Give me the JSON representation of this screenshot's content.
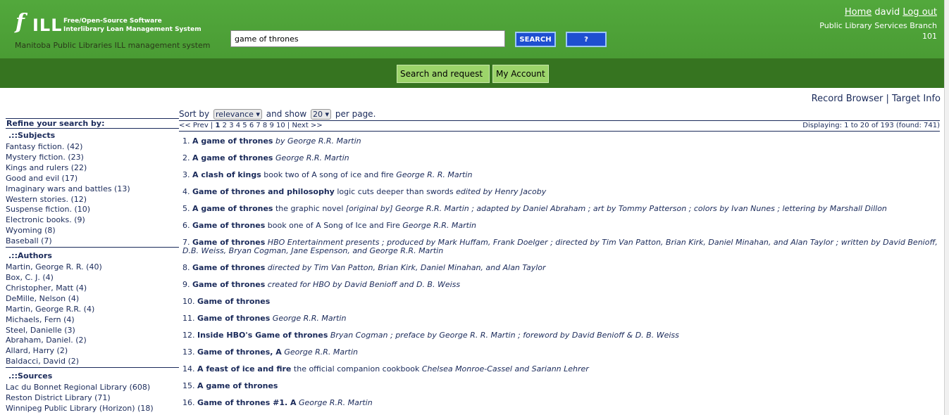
{
  "header": {
    "logo_f": "f",
    "logo_ill": "ILL",
    "logo_tag1": "Free/Open-Source Software",
    "logo_tag2": "Interlibrary Loan Management System",
    "subtitle": "Manitoba Public Libraries ILL management system",
    "search_value": "game of thrones",
    "search_button": "SEARCH",
    "help_button": "?",
    "home_link": "Home",
    "username": "david",
    "logout_link": "Log out",
    "branch": "Public Library Services Branch",
    "branch_num": "101"
  },
  "nav": {
    "search_request": "Search and request",
    "my_account": "My Account"
  },
  "record_links": "Record Browser | Target Info",
  "sidebar": {
    "refine_title": "Refine your search by:",
    "subjects_head": ".::Subjects",
    "subjects": [
      "Fantasy fiction. (42)",
      "Mystery fiction. (23)",
      "Kings and rulers (22)",
      "Good and evil (17)",
      "Imaginary wars and battles (13)",
      "Western stories. (12)",
      "Suspense fiction. (10)",
      "Electronic books. (9)",
      "Wyoming (8)",
      "Baseball (7)"
    ],
    "authors_head": ".::Authors",
    "authors": [
      "Martin, George R. R. (40)",
      "Box, C. J. (4)",
      "Christopher, Matt (4)",
      "DeMille, Nelson (4)",
      "Martin, George R.R. (4)",
      "Michaels, Fern (4)",
      "Steel, Danielle (3)",
      "Abraham, Daniel. (2)",
      "Allard, Harry (2)",
      "Baldacci, David (2)"
    ],
    "sources_head": ".::Sources",
    "sources": [
      "Lac du Bonnet Regional Library (608)",
      "Reston District Library (71)",
      "Winnipeg Public Library (Horizon) (18)"
    ]
  },
  "sort": {
    "sort_by": "Sort by",
    "sort_value": "relevance",
    "show": "and show",
    "show_value": "20",
    "per_page": "per page."
  },
  "pager": {
    "prev": "<< Prev |",
    "current": "1",
    "pages": "2 3 4 5 6 7 8 9 10",
    "next": "| Next >>",
    "displaying": "Displaying: 1 to 20 of 193 (found: 741)"
  },
  "results": [
    {
      "n": "1.",
      "title": "A game of thrones",
      "desc": "",
      "author": "by George R.R. Martin"
    },
    {
      "n": "2.",
      "title": "A game of thrones",
      "desc": "",
      "author": "George R.R. Martin"
    },
    {
      "n": "3.",
      "title": "A clash of kings",
      "desc": "book two of A song of ice and fire",
      "author": "George R. R. Martin"
    },
    {
      "n": "4.",
      "title": "Game of thrones and philosophy",
      "desc": "logic cuts deeper than swords",
      "author": "edited by Henry Jacoby"
    },
    {
      "n": "5.",
      "title": "A game of thrones",
      "desc": "the graphic novel",
      "author": "[original by] George R.R. Martin ; adapted by Daniel Abraham ; art by Tommy Patterson ; colors by Ivan Nunes ; lettering by Marshall Dillon"
    },
    {
      "n": "6.",
      "title": "Game of thrones",
      "desc": "book one of A Song of Ice and Fire",
      "author": "George R.R. Martin"
    },
    {
      "n": "7.",
      "title": "Game of thrones",
      "desc": "",
      "author": "HBO Entertainment presents ; produced by Mark Huffam, Frank Doelger ; directed by Tim Van Patton, Brian Kirk, Daniel Minahan, and Alan Taylor ; written by David Benioff, D.B. Weiss, Bryan Cogman, Jane Espenson, and George R.R. Martin"
    },
    {
      "n": "8.",
      "title": "Game of thrones",
      "desc": "",
      "author": "directed by Tim Van Patton, Brian Kirk, Daniel Minahan, and Alan Taylor"
    },
    {
      "n": "9.",
      "title": "Game of thrones",
      "desc": "",
      "author": "created for HBO by David Benioff and D. B. Weiss"
    },
    {
      "n": "10.",
      "title": "Game of thrones",
      "desc": "",
      "author": ""
    },
    {
      "n": "11.",
      "title": "Game of thrones",
      "desc": "",
      "author": "George R.R. Martin"
    },
    {
      "n": "12.",
      "title": "Inside HBO's Game of thrones",
      "desc": "",
      "author": "Bryan Cogman ; preface by George R. R. Martin ; foreword by David Benioff & D. B. Weiss"
    },
    {
      "n": "13.",
      "title": "Game of thrones, A",
      "desc": "",
      "author": "George R.R. Martin"
    },
    {
      "n": "14.",
      "title": "A feast of ice and fire",
      "desc": "the official companion cookbook",
      "author": "Chelsea Monroe-Cassel and Sariann Lehrer"
    },
    {
      "n": "15.",
      "title": "A game of thrones",
      "desc": "",
      "author": ""
    },
    {
      "n": "16.",
      "title": "Game of thrones #1. A",
      "desc": "",
      "author": "George R.R. Martin"
    }
  ]
}
